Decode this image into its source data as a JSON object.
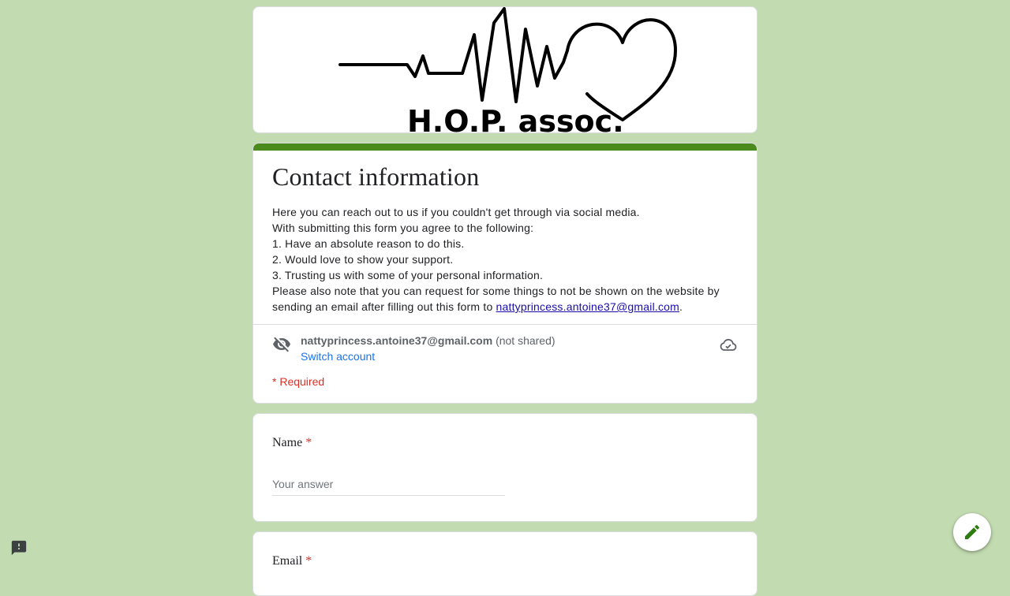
{
  "banner": {
    "logo_text": "H.O.P. assoc."
  },
  "form": {
    "title": "Contact information",
    "description_lines": [
      "Here you can reach out to us if you couldn't get through via social media.",
      "With submitting this form you agree to the following:",
      "1. Have an absolute reason to do this.",
      "2. Would love to show your support.",
      "3. Trusting us with some of your personal information.",
      "Please also note that you can request for some things to not be shown on the website by"
    ],
    "description_last_prefix": "sending an email after filling out this form to ",
    "description_link": "nattyprincess.antoine37@gmail.com",
    "description_last_suffix": "."
  },
  "account": {
    "email": "nattyprincess.antoine37@gmail.com",
    "not_shared": "(not shared)",
    "switch_label": "Switch account",
    "hidden_icon": "eye-off-icon",
    "saved_icon": "cloud-done-icon"
  },
  "required_note": "* Required",
  "questions": [
    {
      "label": "Name",
      "required_mark": "*",
      "placeholder": "Your answer"
    },
    {
      "label": "Email",
      "required_mark": "*"
    }
  ],
  "colors": {
    "background": "#c2dbb0",
    "accent": "#4b8a1c",
    "required": "#d93025",
    "link": "#1a73e8"
  },
  "fab_icon": "pencil-icon",
  "report_icon": "report-problem-icon"
}
